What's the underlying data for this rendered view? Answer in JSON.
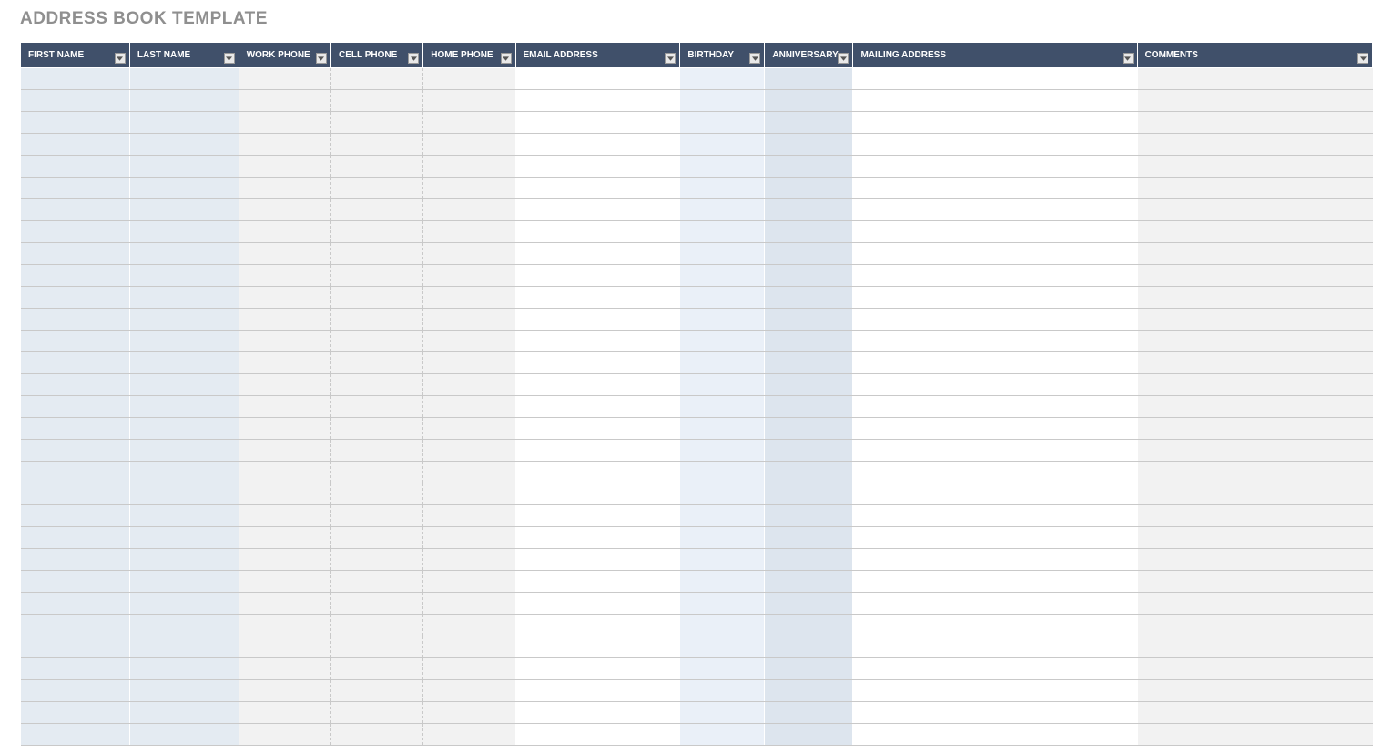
{
  "title": "ADDRESS BOOK TEMPLATE",
  "columns": {
    "first_name": "FIRST NAME",
    "last_name": "LAST NAME",
    "work_phone": "WORK PHONE",
    "cell_phone": "CELL PHONE",
    "home_phone": "HOME PHONE",
    "email": "EMAIL ADDRESS",
    "birthday": "BIRTHDAY",
    "anniversary": "ANNIVERSARY",
    "mailing_address": "MAILING ADDRESS",
    "comments": "COMMENTS"
  },
  "rows": [
    {},
    {},
    {},
    {},
    {},
    {},
    {},
    {},
    {},
    {},
    {},
    {},
    {},
    {},
    {},
    {},
    {},
    {},
    {},
    {},
    {},
    {},
    {},
    {},
    {},
    {},
    {},
    {},
    {},
    {},
    {}
  ]
}
